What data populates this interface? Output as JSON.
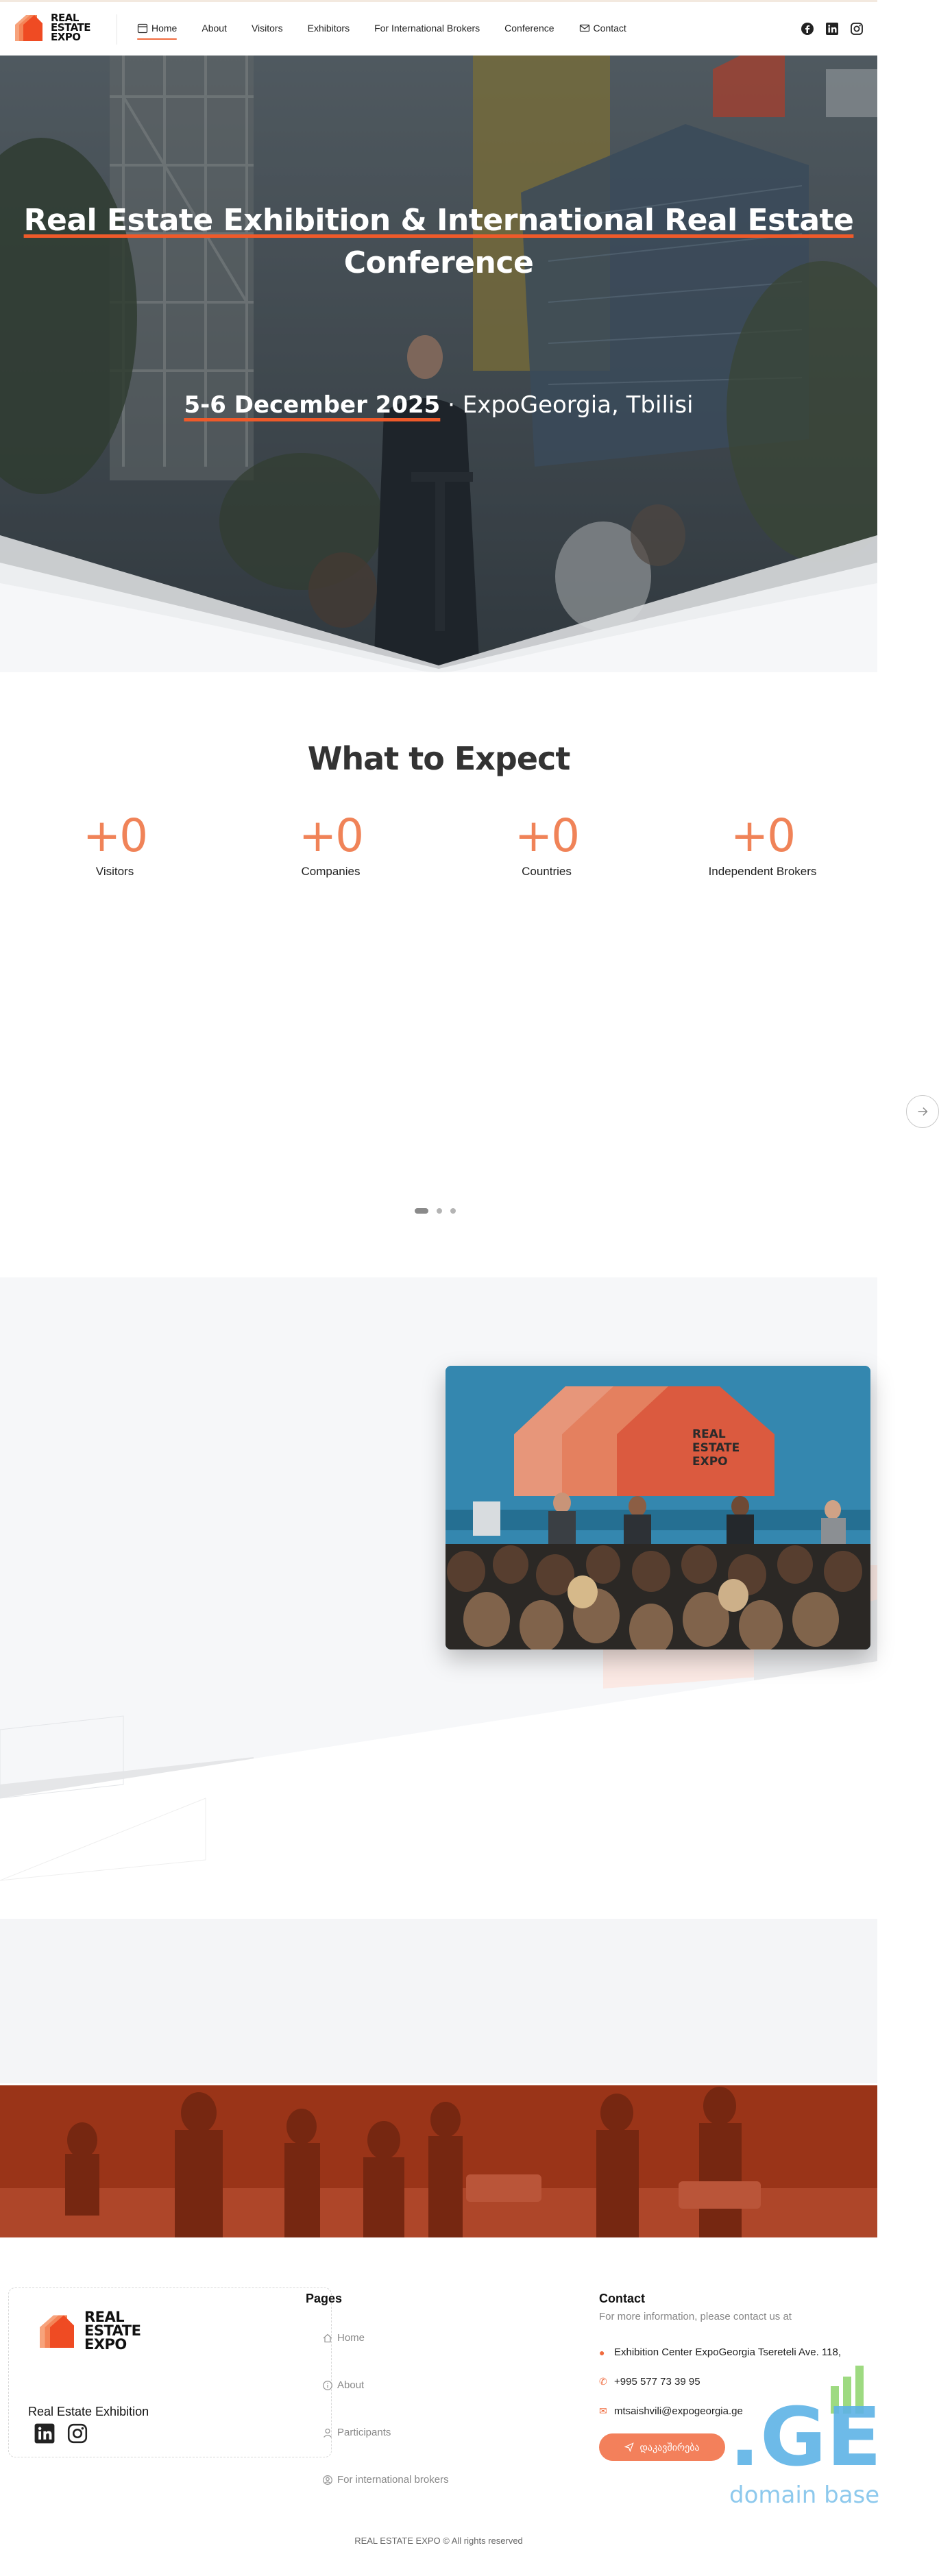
{
  "header": {
    "logo_lines": [
      "REAL",
      "ESTATE",
      "EXPO"
    ],
    "nav": [
      {
        "label": "Home",
        "icon": "calendar-icon",
        "active": true
      },
      {
        "label": "About"
      },
      {
        "label": "Visitors"
      },
      {
        "label": "Exhibitors"
      },
      {
        "label": "For International Brokers"
      },
      {
        "label": "Conference"
      },
      {
        "label": "Contact",
        "icon": "mail-icon"
      }
    ],
    "socials": [
      "facebook-icon",
      "linkedin-icon",
      "instagram-icon"
    ]
  },
  "hero": {
    "title_part1": "Real Estate Exhibition & International Real Estate",
    "title_part2": "Conference",
    "date": "5-6 December 2025",
    "location": " · ExpoGeorgia, Tbilisi"
  },
  "expect": {
    "title": "What to Expect",
    "stats": [
      {
        "value": "+0",
        "label": "Visitors"
      },
      {
        "value": "+0",
        "label": "Companies"
      },
      {
        "value": "+0",
        "label": "Countries"
      },
      {
        "value": "+0",
        "label": "Independent Brokers"
      }
    ],
    "slider_dots": 3,
    "active_dot": 0
  },
  "footer": {
    "logo_lines": [
      "REAL",
      "ESTATE",
      "EXPO"
    ],
    "name": "Real Estate Exhibition",
    "pages_title": "Pages",
    "pages": [
      "Home",
      "About",
      "Participants",
      "For international brokers"
    ],
    "contact_title": "Contact",
    "contact_sub": "For more information, please contact us at",
    "address": "Exhibition Center ExpoGeorgia Tsereteli Ave. 118,",
    "phone": "+995 577 73 39 95",
    "email": "mtsaishvili@expogeorgia.ge",
    "contact_button": "დაკავშირება",
    "badge_text": ".GE",
    "badge_sub": "domain base",
    "copyright": "REAL ESTATE EXPO © All rights reserved"
  },
  "colors": {
    "accent": "#f06b3e",
    "stat": "#f08358",
    "dark_red": "#8c2a12"
  }
}
